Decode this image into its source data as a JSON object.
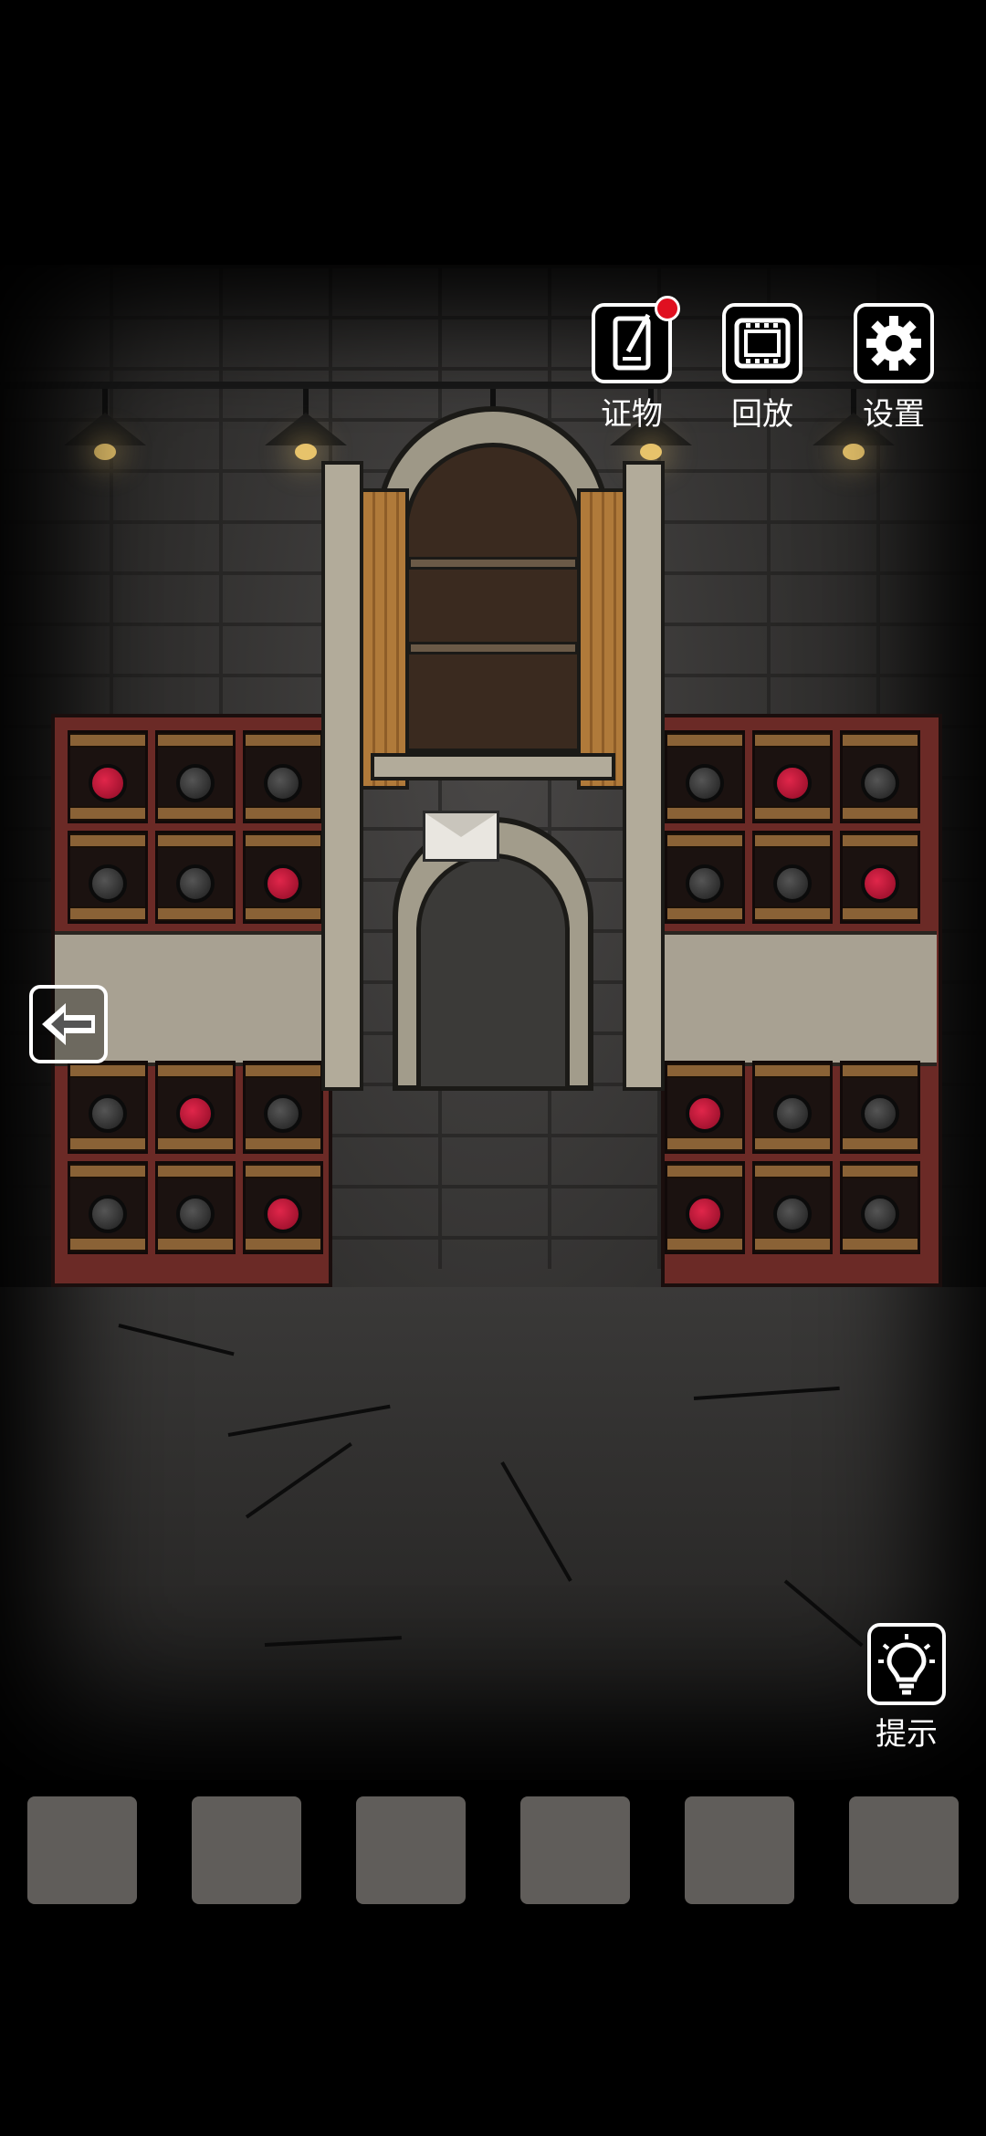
{
  "toolbar": {
    "evidence_label": "证物",
    "replay_label": "回放",
    "settings_label": "设置"
  },
  "hint": {
    "label": "提示"
  },
  "icons": {
    "evidence": "notebook-pen-icon",
    "replay": "film-strip-icon",
    "settings": "gear-icon",
    "back": "arrow-left-icon",
    "hint": "lightbulb-icon"
  },
  "colors": {
    "notification_dot": "#e01020",
    "wine_red": "#c8173b",
    "rack": "#6b2a26"
  },
  "left_rack_bottles": [
    "red",
    "dark",
    "dark",
    "dark",
    "dark",
    "red",
    "dark",
    "red",
    "dark",
    "dark",
    "dark",
    "red"
  ],
  "right_rack_bottles": [
    "dark",
    "red",
    "dark",
    "dark",
    "dark",
    "red",
    "red",
    "dark",
    "dark",
    "red",
    "dark",
    "dark"
  ],
  "inventory": {
    "slots": [
      "",
      "",
      "",
      "",
      "",
      ""
    ]
  }
}
